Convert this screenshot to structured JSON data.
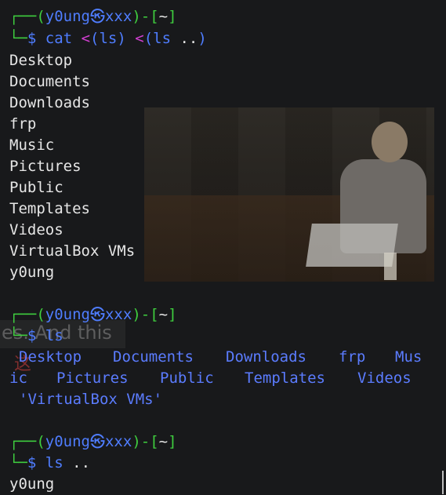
{
  "prompt": {
    "user": "y0ung",
    "host": "xxx",
    "dir": "~",
    "at_symbol": "㉿"
  },
  "blocks": [
    {
      "command_parts": [
        "cat",
        "<(ls)",
        "<(ls",
        "..)"
      ],
      "output_lines": [
        "Desktop",
        "Documents",
        "Downloads",
        "frp",
        "Music",
        "Pictures",
        "Public",
        "Templates",
        "Videos",
        "VirtualBox VMs",
        "y0ung"
      ]
    },
    {
      "command_parts": [
        "ls"
      ],
      "ls_rows": [
        [
          "Desktop",
          "Documents",
          "Downloads",
          "frp",
          "Mus"
        ],
        [
          "ic",
          "Pictures",
          "Public",
          "Templates",
          "Videos"
        ],
        [
          "'VirtualBox VMs'"
        ]
      ]
    },
    {
      "command_parts": [
        "ls",
        ".."
      ],
      "output_lines": [
        "y0ung"
      ]
    }
  ],
  "overlay_text": "es. And this",
  "overlay_red_text": "这",
  "colors": {
    "background": "#18191b",
    "prompt_green": "#3fcf3f",
    "prompt_blue": "#4f7dff",
    "redirect_magenta": "#d13fd1",
    "dir_blue": "#5b7cff",
    "text": "#e6e6e6"
  }
}
